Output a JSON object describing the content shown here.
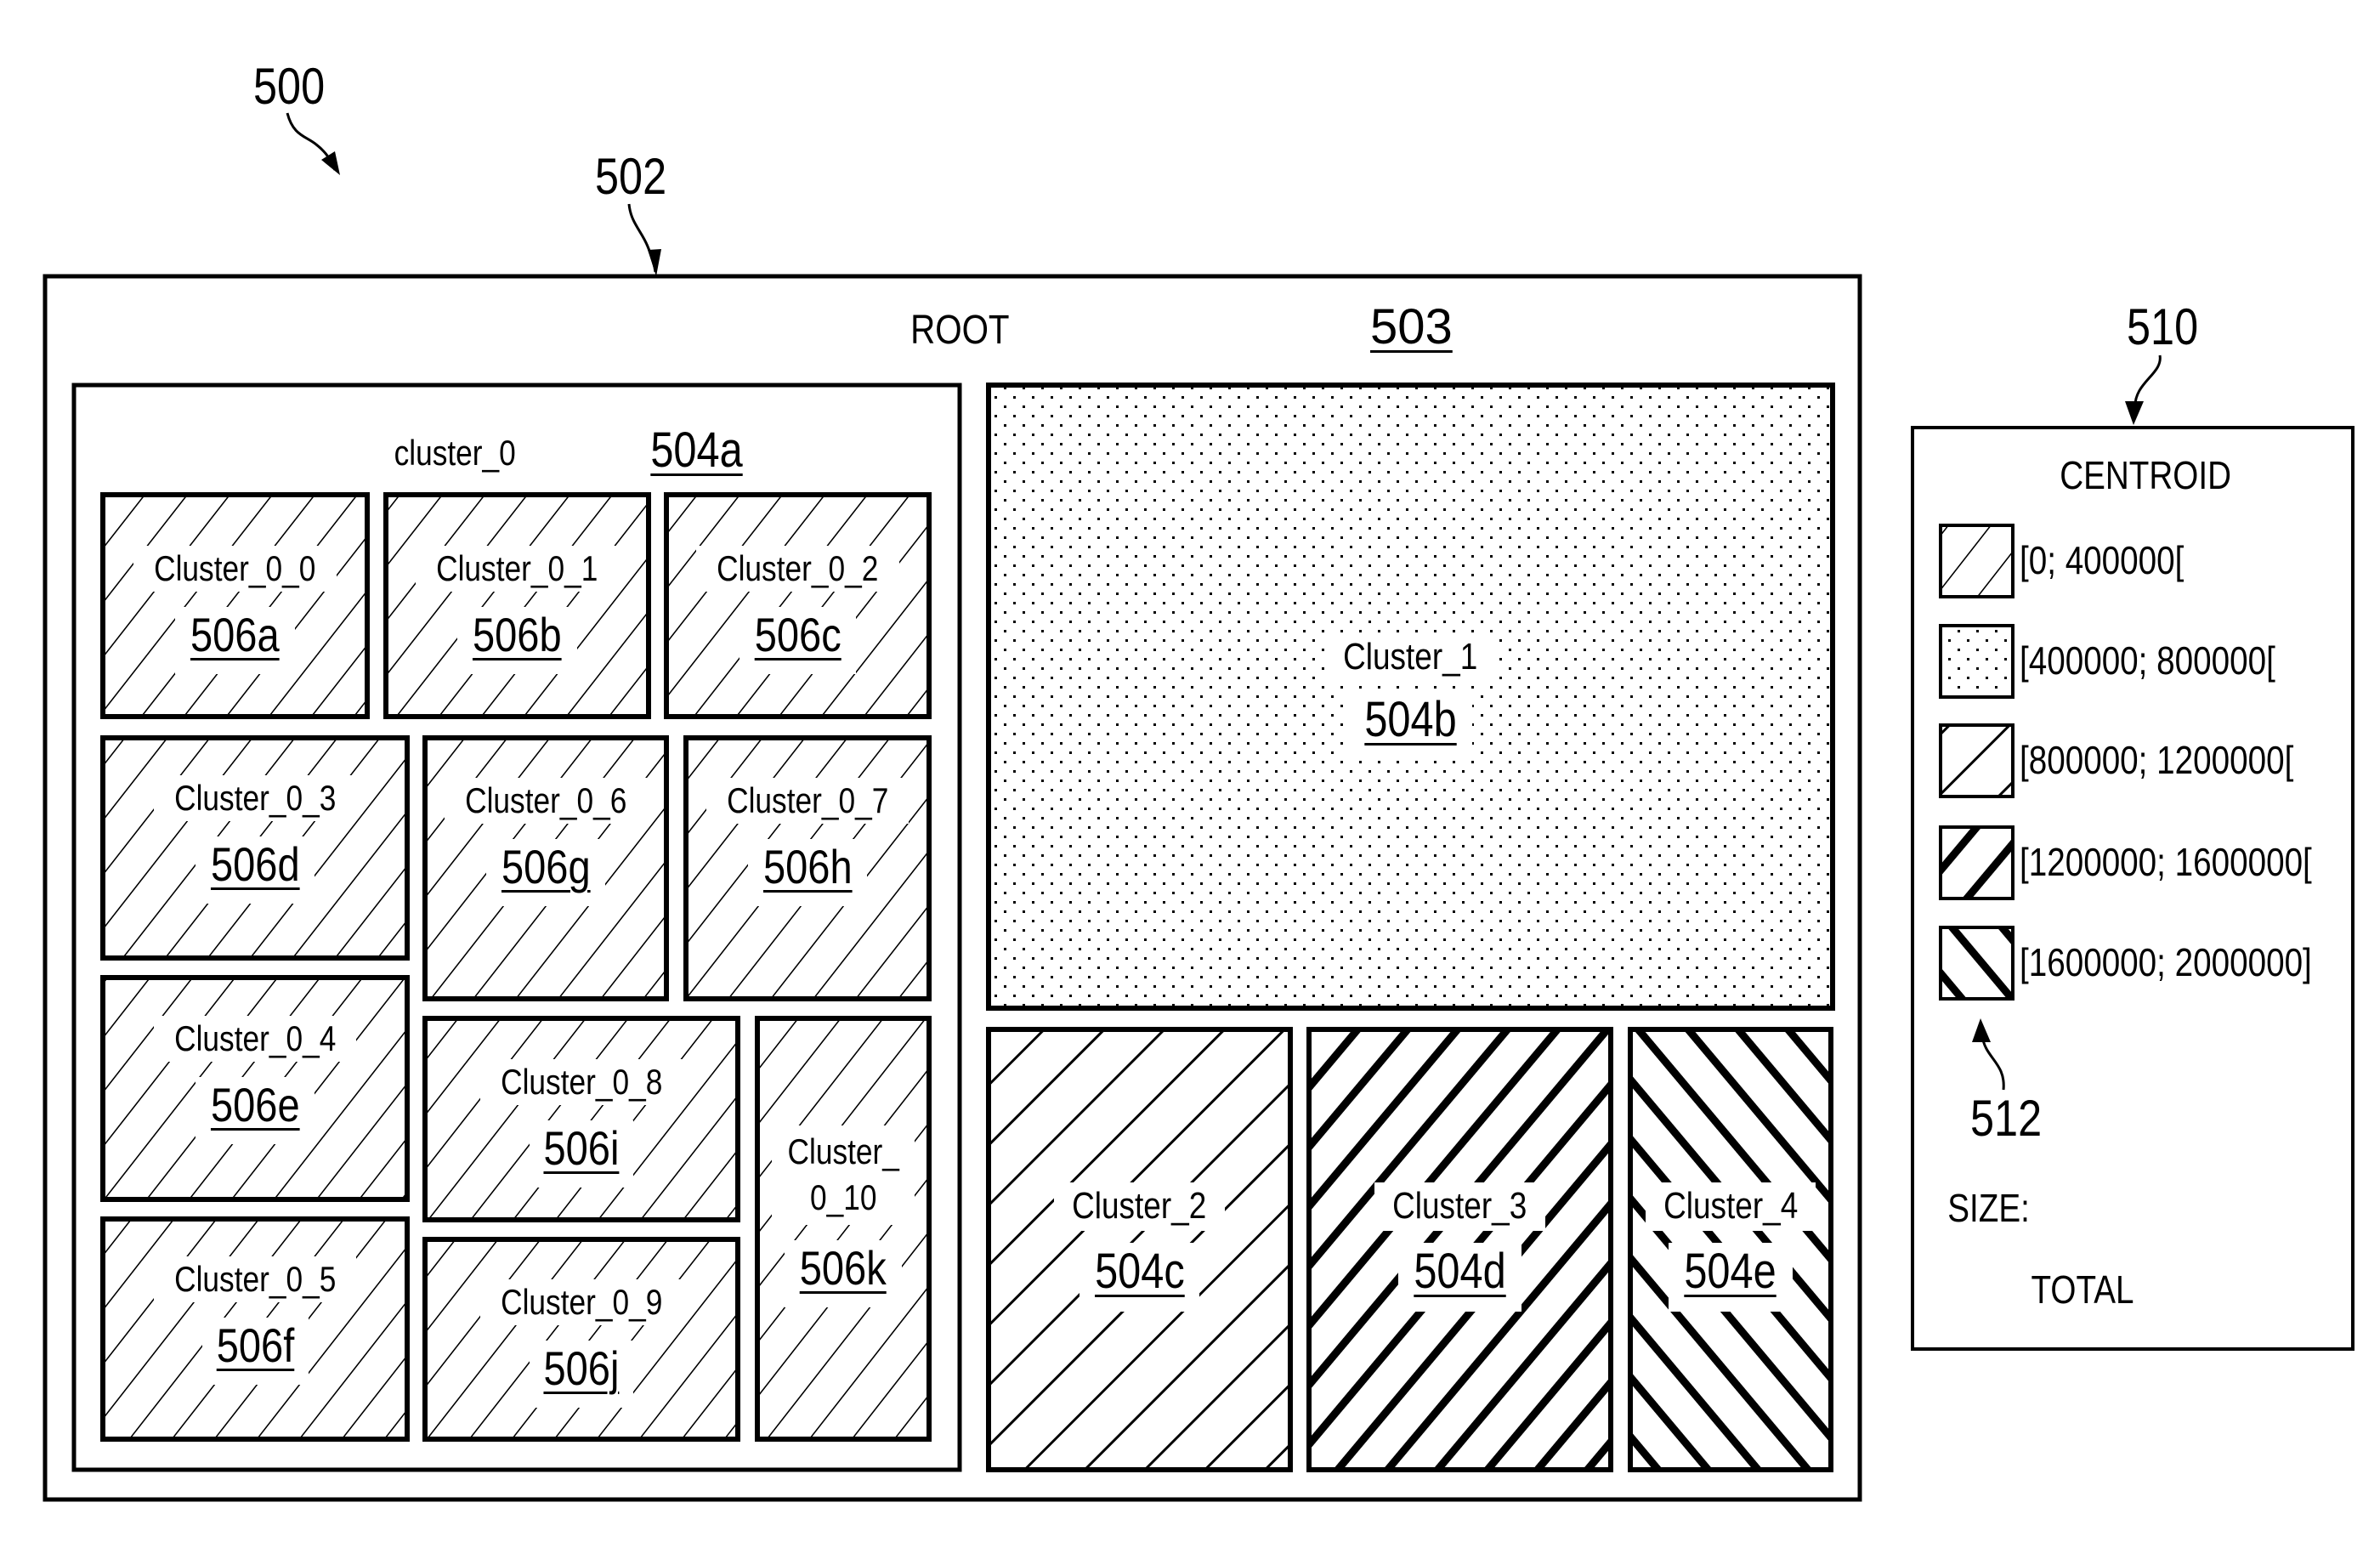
{
  "figure": {
    "figure_ref": "500",
    "treemap_ref": "502",
    "root_ref": "503",
    "root_label": "ROOT",
    "legend_ref": "510",
    "swatch_ref": "512"
  },
  "colors": {
    "ink": "#000000",
    "paper": "#ffffff"
  },
  "nodes": [
    {
      "id": "cluster_0",
      "label": "cluster_0",
      "ref": "504a",
      "centroid_bin": 0,
      "container": true
    },
    {
      "id": "cluster_1",
      "label": "Cluster_1",
      "ref": "504b",
      "centroid_bin": 1
    },
    {
      "id": "cluster_2",
      "label": "Cluster_2",
      "ref": "504c",
      "centroid_bin": 2
    },
    {
      "id": "cluster_3",
      "label": "Cluster_3",
      "ref": "504d",
      "centroid_bin": 3
    },
    {
      "id": "cluster_4",
      "label": "Cluster_4",
      "ref": "504e",
      "centroid_bin": 4
    },
    {
      "id": "cluster_0_0",
      "label": "Cluster_0_0",
      "ref": "506a",
      "centroid_bin": 0
    },
    {
      "id": "cluster_0_1",
      "label": "Cluster_0_1",
      "ref": "506b",
      "centroid_bin": 0
    },
    {
      "id": "cluster_0_2",
      "label": "Cluster_0_2",
      "ref": "506c",
      "centroid_bin": 0
    },
    {
      "id": "cluster_0_3",
      "label": "Cluster_0_3",
      "ref": "506d",
      "centroid_bin": 0
    },
    {
      "id": "cluster_0_4",
      "label": "Cluster_0_4",
      "ref": "506e",
      "centroid_bin": 0
    },
    {
      "id": "cluster_0_5",
      "label": "Cluster_0_5",
      "ref": "506f",
      "centroid_bin": 0
    },
    {
      "id": "cluster_0_6",
      "label": "Cluster_0_6",
      "ref": "506g",
      "centroid_bin": 0
    },
    {
      "id": "cluster_0_7",
      "label": "Cluster_0_7",
      "ref": "506h",
      "centroid_bin": 0
    },
    {
      "id": "cluster_0_8",
      "label": "Cluster_0_8",
      "ref": "506i",
      "centroid_bin": 0
    },
    {
      "id": "cluster_0_9",
      "label": "Cluster_0_9",
      "ref": "506j",
      "centroid_bin": 0
    },
    {
      "id": "cluster_0_10",
      "label": "Cluster_\n0_10",
      "ref": "506k",
      "centroid_bin": 0
    }
  ],
  "legend": {
    "title": "CENTROID",
    "bins": [
      {
        "range": "[0; 400000[",
        "pattern": "thin-hatch-up"
      },
      {
        "range": "[400000; 800000[",
        "pattern": "dots"
      },
      {
        "range": "[800000; 1200000[",
        "pattern": "thin-hatch-down"
      },
      {
        "range": "[1200000; 1600000[",
        "pattern": "thick-hatch-up"
      },
      {
        "range": "[1600000; 2000000]",
        "pattern": "thick-hatch-down"
      }
    ],
    "size_label": "SIZE:",
    "size_value": "TOTAL"
  }
}
